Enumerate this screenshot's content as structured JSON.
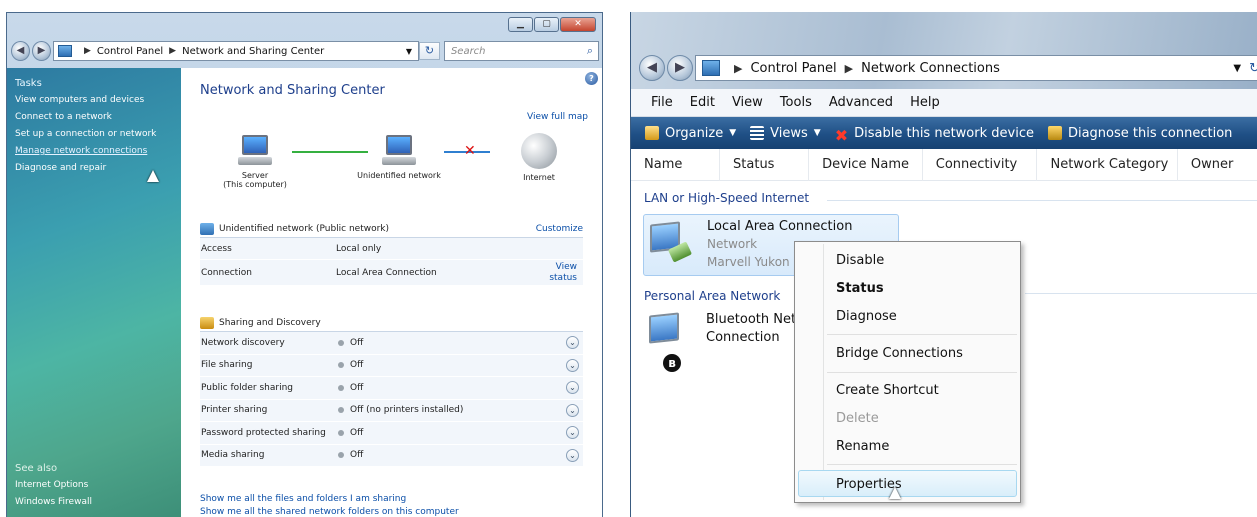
{
  "left_window": {
    "address": {
      "crumbs": [
        "Control Panel",
        "Network and Sharing Center"
      ],
      "search_placeholder": "Search"
    },
    "tasks": {
      "heading": "Tasks",
      "links": [
        "View computers and devices",
        "Connect to a network",
        "Set up a connection or network",
        "Manage network connections",
        "Diagnose and repair"
      ]
    },
    "see_also": {
      "heading": "See also",
      "links": [
        "Internet Options",
        "Windows Firewall"
      ]
    },
    "main": {
      "title": "Network and Sharing Center",
      "view_full_map": "View full map",
      "map": {
        "server_label": "Server",
        "server_sublabel": "(This computer)",
        "network_label": "Unidentified network",
        "internet_label": "Internet"
      },
      "network": {
        "name": "Unidentified network (Public network)",
        "customize": "Customize",
        "access_label": "Access",
        "access_value": "Local only",
        "connection_label": "Connection",
        "connection_value": "Local Area Connection",
        "view_status_1": "View",
        "view_status_2": "status"
      },
      "sharing": {
        "heading": "Sharing and Discovery",
        "rows": [
          {
            "label": "Network discovery",
            "value": "Off"
          },
          {
            "label": "File sharing",
            "value": "Off"
          },
          {
            "label": "Public folder sharing",
            "value": "Off"
          },
          {
            "label": "Printer sharing",
            "value": "Off (no printers installed)"
          },
          {
            "label": "Password protected sharing",
            "value": "Off"
          },
          {
            "label": "Media sharing",
            "value": "Off"
          }
        ]
      },
      "links": [
        "Show me all the files and folders I am sharing",
        "Show me all the shared network folders on this computer"
      ]
    }
  },
  "right_window": {
    "address": {
      "crumbs": [
        "Control Panel",
        "Network Connections"
      ]
    },
    "menu": [
      "File",
      "Edit",
      "View",
      "Tools",
      "Advanced",
      "Help"
    ],
    "toolbar": {
      "organize": "Organize",
      "views": "Views",
      "disable": "Disable this network device",
      "diagnose": "Diagnose this connection"
    },
    "columns": [
      "Name",
      "Status",
      "Device Name",
      "Connectivity",
      "Network Category",
      "Owner"
    ],
    "groups": {
      "lan": "LAN or High-Speed Internet",
      "pan": "Personal Area Network"
    },
    "items": {
      "local": {
        "name": "Local Area Connection",
        "status": "Network",
        "device": "Marvell Yukon"
      },
      "bluetooth": {
        "name_1": "Bluetooth Net",
        "name_2": "Connection"
      }
    },
    "context_menu": [
      "Disable",
      "Status",
      "Diagnose",
      "Bridge Connections",
      "Create Shortcut",
      "Delete",
      "Rename",
      "Properties"
    ]
  },
  "colors": {
    "link": "#0b4fa8",
    "title": "#1e3f8c",
    "toolbar": "#1f4f85",
    "tasks_pane": "#3b9fb0"
  }
}
